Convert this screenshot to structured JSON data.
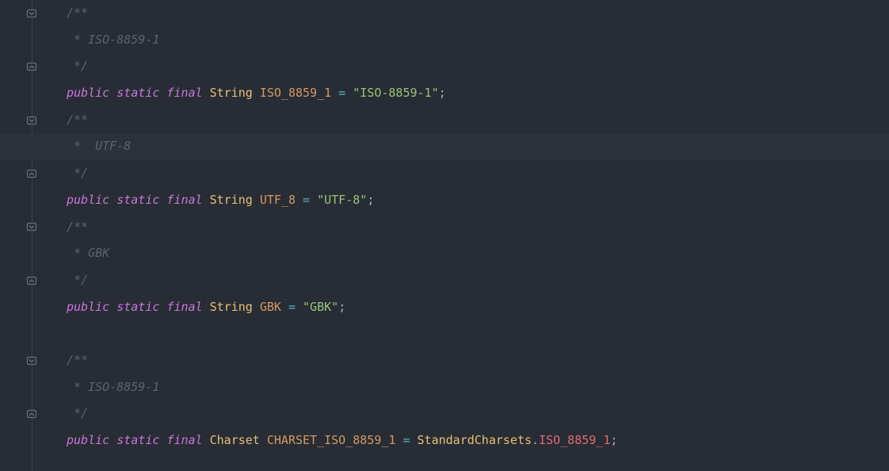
{
  "lines": [
    {
      "fold": "down-box",
      "hl": false,
      "tokens": [
        {
          "cls": "tok-comment",
          "t": "/**"
        }
      ]
    },
    {
      "fold": null,
      "hl": false,
      "tokens": [
        {
          "cls": "tok-comment",
          "t": " * ISO-8859-1"
        }
      ]
    },
    {
      "fold": "up-box",
      "hl": false,
      "tokens": [
        {
          "cls": "tok-comment",
          "t": " */"
        }
      ]
    },
    {
      "fold": null,
      "hl": false,
      "tokens": [
        {
          "cls": "tok-keyword",
          "t": "public"
        },
        {
          "cls": "",
          "t": " "
        },
        {
          "cls": "tok-keyword",
          "t": "static"
        },
        {
          "cls": "",
          "t": " "
        },
        {
          "cls": "tok-keyword",
          "t": "final"
        },
        {
          "cls": "",
          "t": " "
        },
        {
          "cls": "tok-type",
          "t": "String"
        },
        {
          "cls": "",
          "t": " "
        },
        {
          "cls": "tok-const",
          "t": "ISO_8859_1"
        },
        {
          "cls": "",
          "t": " "
        },
        {
          "cls": "tok-op",
          "t": "="
        },
        {
          "cls": "",
          "t": " "
        },
        {
          "cls": "tok-string",
          "t": "\"ISO-8859-1\""
        },
        {
          "cls": "tok-punct",
          "t": ";"
        }
      ]
    },
    {
      "fold": "down-box",
      "hl": false,
      "tokens": [
        {
          "cls": "tok-comment",
          "t": "/**"
        }
      ]
    },
    {
      "fold": null,
      "hl": true,
      "tokens": [
        {
          "cls": "tok-comment",
          "t": " *  UTF-8"
        }
      ]
    },
    {
      "fold": "up-box",
      "hl": false,
      "tokens": [
        {
          "cls": "tok-comment",
          "t": " */"
        }
      ]
    },
    {
      "fold": null,
      "hl": false,
      "tokens": [
        {
          "cls": "tok-keyword",
          "t": "public"
        },
        {
          "cls": "",
          "t": " "
        },
        {
          "cls": "tok-keyword",
          "t": "static"
        },
        {
          "cls": "",
          "t": " "
        },
        {
          "cls": "tok-keyword",
          "t": "final"
        },
        {
          "cls": "",
          "t": " "
        },
        {
          "cls": "tok-type",
          "t": "String"
        },
        {
          "cls": "",
          "t": " "
        },
        {
          "cls": "tok-const",
          "t": "UTF_8"
        },
        {
          "cls": "",
          "t": " "
        },
        {
          "cls": "tok-op",
          "t": "="
        },
        {
          "cls": "",
          "t": " "
        },
        {
          "cls": "tok-string",
          "t": "\"UTF-8\""
        },
        {
          "cls": "tok-punct",
          "t": ";"
        }
      ]
    },
    {
      "fold": "down-box",
      "hl": false,
      "tokens": [
        {
          "cls": "tok-comment",
          "t": "/**"
        }
      ]
    },
    {
      "fold": null,
      "hl": false,
      "tokens": [
        {
          "cls": "tok-comment",
          "t": " * GBK"
        }
      ]
    },
    {
      "fold": "up-box",
      "hl": false,
      "tokens": [
        {
          "cls": "tok-comment",
          "t": " */"
        }
      ]
    },
    {
      "fold": null,
      "hl": false,
      "tokens": [
        {
          "cls": "tok-keyword",
          "t": "public"
        },
        {
          "cls": "",
          "t": " "
        },
        {
          "cls": "tok-keyword",
          "t": "static"
        },
        {
          "cls": "",
          "t": " "
        },
        {
          "cls": "tok-keyword",
          "t": "final"
        },
        {
          "cls": "",
          "t": " "
        },
        {
          "cls": "tok-type",
          "t": "String"
        },
        {
          "cls": "",
          "t": " "
        },
        {
          "cls": "tok-const",
          "t": "GBK"
        },
        {
          "cls": "",
          "t": " "
        },
        {
          "cls": "tok-op",
          "t": "="
        },
        {
          "cls": "",
          "t": " "
        },
        {
          "cls": "tok-string",
          "t": "\"GBK\""
        },
        {
          "cls": "tok-punct",
          "t": ";"
        }
      ]
    },
    {
      "fold": null,
      "hl": false,
      "tokens": []
    },
    {
      "fold": "down-box",
      "hl": false,
      "tokens": [
        {
          "cls": "tok-comment",
          "t": "/**"
        }
      ]
    },
    {
      "fold": null,
      "hl": false,
      "tokens": [
        {
          "cls": "tok-comment",
          "t": " * ISO-8859-1"
        }
      ]
    },
    {
      "fold": "up-box",
      "hl": false,
      "tokens": [
        {
          "cls": "tok-comment",
          "t": " */"
        }
      ]
    },
    {
      "fold": null,
      "hl": false,
      "tokens": [
        {
          "cls": "tok-keyword",
          "t": "public"
        },
        {
          "cls": "",
          "t": " "
        },
        {
          "cls": "tok-keyword",
          "t": "static"
        },
        {
          "cls": "",
          "t": " "
        },
        {
          "cls": "tok-keyword",
          "t": "final"
        },
        {
          "cls": "",
          "t": " "
        },
        {
          "cls": "tok-type",
          "t": "Charset"
        },
        {
          "cls": "",
          "t": " "
        },
        {
          "cls": "tok-const",
          "t": "CHARSET_ISO_8859_1"
        },
        {
          "cls": "",
          "t": " "
        },
        {
          "cls": "tok-op",
          "t": "="
        },
        {
          "cls": "",
          "t": " "
        },
        {
          "cls": "tok-class",
          "t": "StandardCharsets"
        },
        {
          "cls": "tok-punct",
          "t": "."
        },
        {
          "cls": "tok-ident",
          "t": "ISO_8859_1"
        },
        {
          "cls": "tok-punct",
          "t": ";"
        }
      ]
    }
  ]
}
